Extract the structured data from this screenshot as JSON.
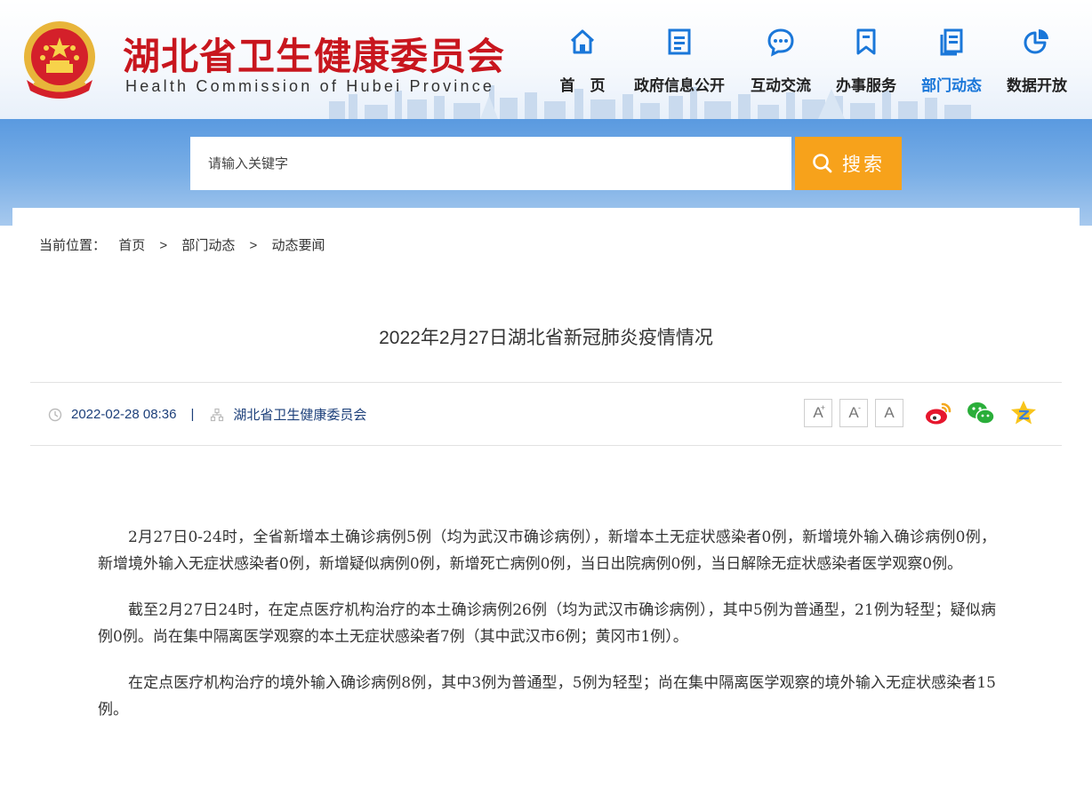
{
  "header": {
    "title": "湖北省卫生健康委员会",
    "subtitle": "Health Commission of Hubei Province",
    "nav": [
      {
        "label": "首　页",
        "icon": "home-icon"
      },
      {
        "label": "政府信息公开",
        "icon": "document-icon"
      },
      {
        "label": "互动交流",
        "icon": "chat-icon"
      },
      {
        "label": "办事服务",
        "icon": "bookmark-icon"
      },
      {
        "label": "部门动态",
        "icon": "news-icon",
        "active": true
      },
      {
        "label": "数据开放",
        "icon": "pie-chart-icon"
      }
    ],
    "active_color": "#1a77d9",
    "title_color": "#c8161e"
  },
  "search": {
    "placeholder": "请输入关键字",
    "button_label": "搜索",
    "button_color": "#f7a21b"
  },
  "breadcrumb": {
    "prefix": "当前位置：",
    "items": [
      "首页",
      "部门动态",
      "动态要闻"
    ],
    "separator": ">"
  },
  "article": {
    "title": "2022年2月27日湖北省新冠肺炎疫情情况",
    "date": "2022-02-28 08:36",
    "meta_divider": "|",
    "source": "湖北省卫生健康委员会",
    "font_buttons": [
      "A",
      "A",
      "A"
    ],
    "font_button_marks": [
      "+",
      "-"
    ],
    "share_icons": [
      "weibo-icon",
      "wechat-icon",
      "qzone-icon"
    ],
    "paragraphs": [
      "2月27日0-24时，全省新增本土确诊病例5例（均为武汉市确诊病例），新增本土无症状感染者0例，新增境外输入确诊病例0例，新增境外输入无症状感染者0例，新增疑似病例0例，新增死亡病例0例，当日出院病例0例，当日解除无症状感染者医学观察0例。",
      "截至2月27日24时，在定点医疗机构治疗的本土确诊病例26例（均为武汉市确诊病例），其中5例为普通型，21例为轻型；疑似病例0例。尚在集中隔离医学观察的本土无症状感染者7例（其中武汉市6例；黄冈市1例）。",
      "在定点医疗机构治疗的境外输入确诊病例8例，其中3例为普通型，5例为轻型；尚在集中隔离医学观察的境外输入无症状感染者15例。"
    ]
  }
}
